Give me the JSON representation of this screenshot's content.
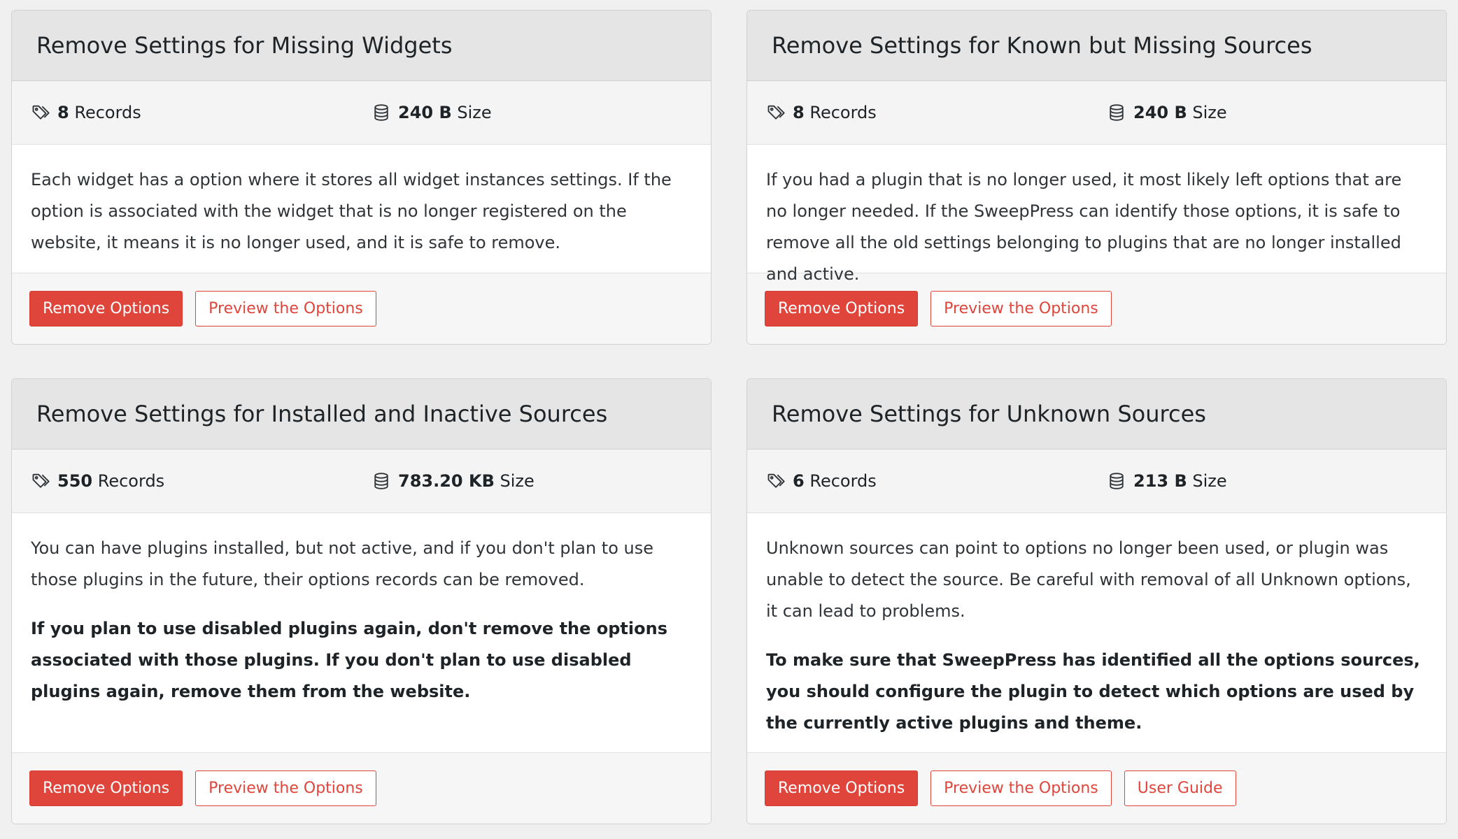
{
  "colors": {
    "accent": "#e0453c",
    "header_bg": "#e5e5e5",
    "stats_bg": "#f4f4f4"
  },
  "icons": {
    "records": "tag-icon",
    "size": "database-icon"
  },
  "cards": [
    {
      "title": "Remove Settings for Missing Widgets",
      "records_value": "8",
      "records_label": "Records",
      "size_value": "240 B",
      "size_label": "Size",
      "paragraphs": [
        "Each widget has a option where it stores all widget instances settings. If the option is associated with the widget that is no longer registered on the website, it means it is no longer used, and it is safe to remove."
      ],
      "bold_paragraph": "",
      "buttons": {
        "primary": "Remove Options",
        "preview": "Preview the Options",
        "guide": ""
      }
    },
    {
      "title": "Remove Settings for Known but Missing Sources",
      "records_value": "8",
      "records_label": "Records",
      "size_value": "240 B",
      "size_label": "Size",
      "paragraphs": [
        "If you had a plugin that is no longer used, it most likely left options that are no longer needed. If the SweepPress can identify those options, it is safe to remove all the old settings belonging to plugins that are no longer installed and active."
      ],
      "bold_paragraph": "",
      "buttons": {
        "primary": "Remove Options",
        "preview": "Preview the Options",
        "guide": ""
      }
    },
    {
      "title": "Remove Settings for Installed and Inactive Sources",
      "records_value": "550",
      "records_label": "Records",
      "size_value": "783.20 KB",
      "size_label": "Size",
      "paragraphs": [
        "You can have plugins installed, but not active, and if you don't plan to use those plugins in the future, their options records can be removed."
      ],
      "bold_paragraph": "If you plan to use disabled plugins again, don't remove the options associated with those plugins. If you don't plan to use disabled plugins again, remove them from the website.",
      "buttons": {
        "primary": "Remove Options",
        "preview": "Preview the Options",
        "guide": ""
      }
    },
    {
      "title": "Remove Settings for Unknown Sources",
      "records_value": "6",
      "records_label": "Records",
      "size_value": "213 B",
      "size_label": "Size",
      "paragraphs": [
        "Unknown sources can point to options no longer been used, or plugin was unable to detect the source. Be careful with removal of all Unknown options, it can lead to problems."
      ],
      "bold_paragraph": "To make sure that SweepPress has identified all the options sources, you should configure the plugin to detect which options are used by the currently active plugins and theme.",
      "buttons": {
        "primary": "Remove Options",
        "preview": "Preview the Options",
        "guide": "User Guide"
      }
    }
  ]
}
